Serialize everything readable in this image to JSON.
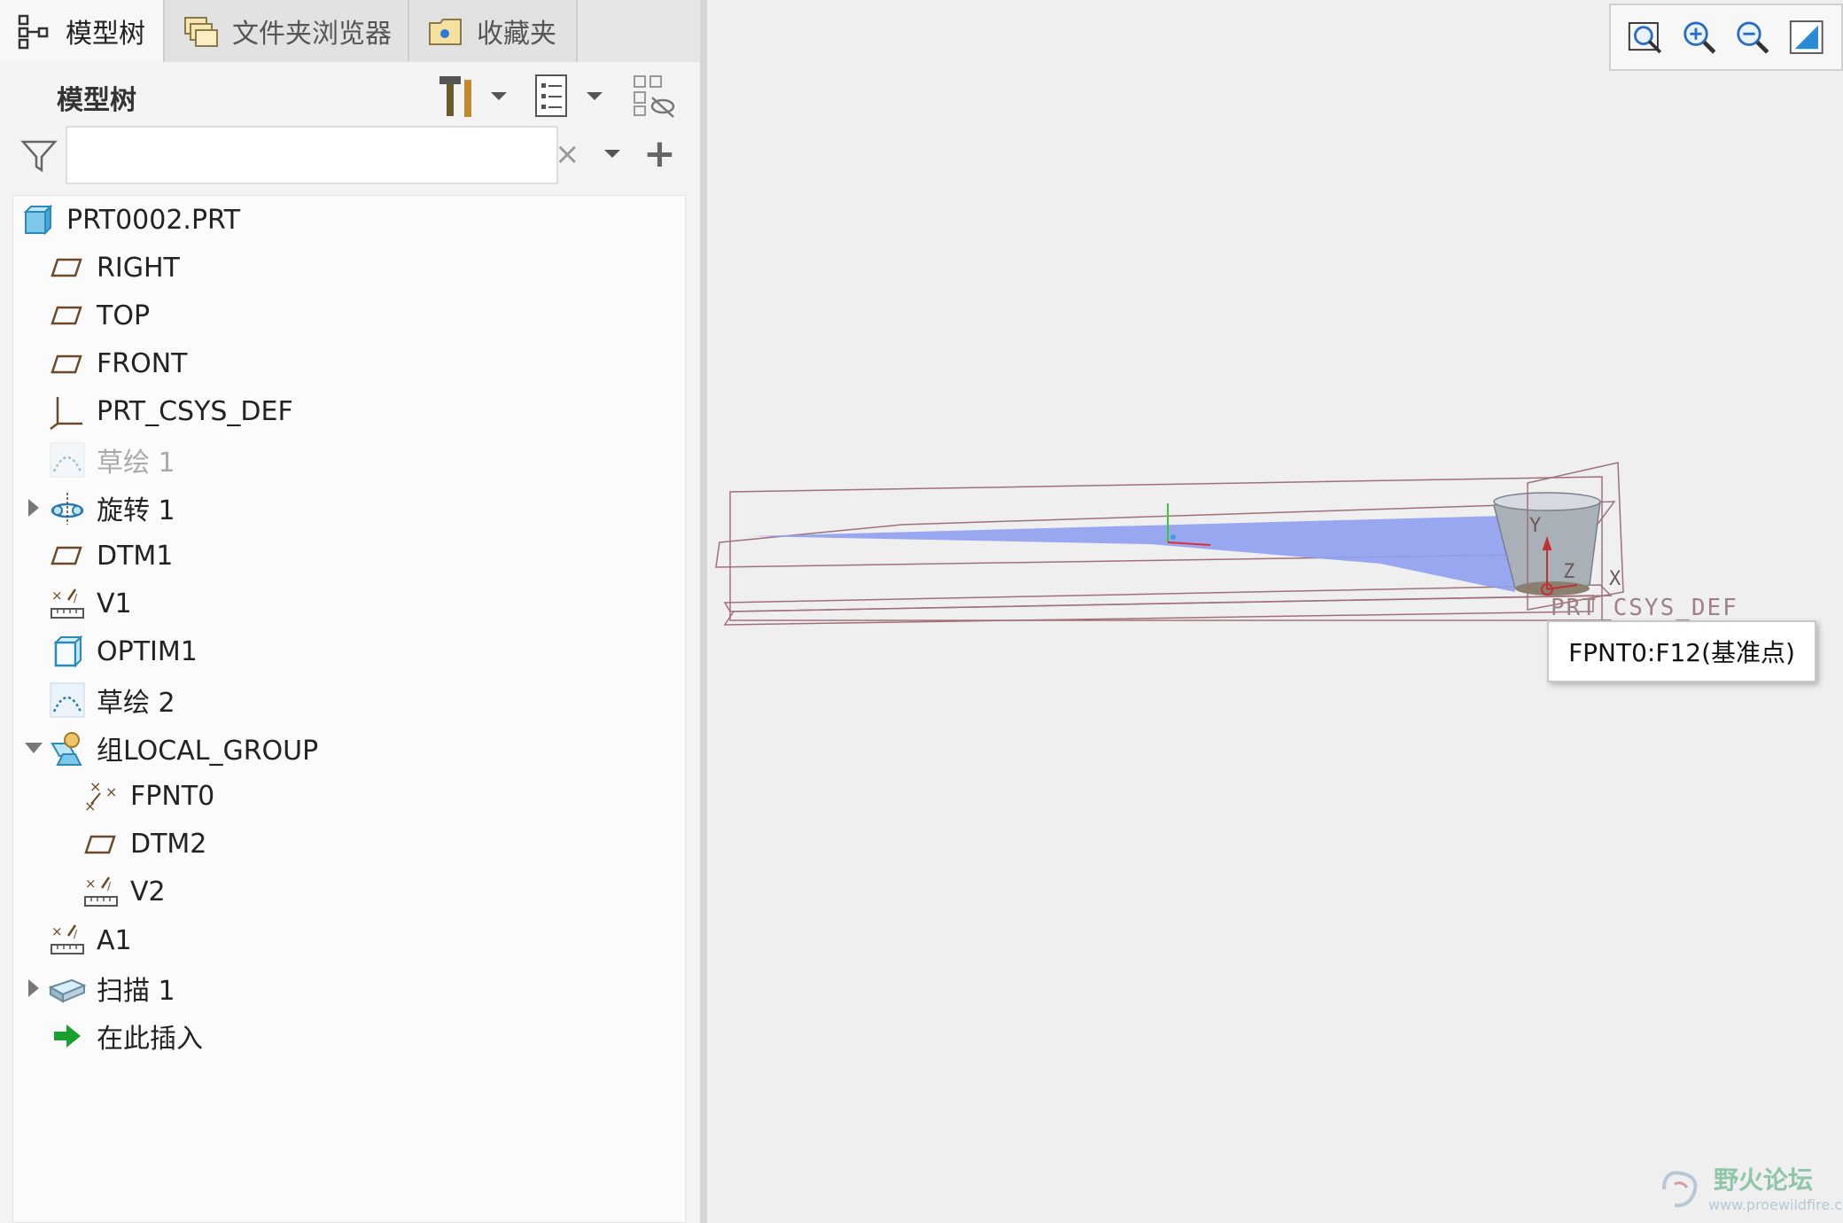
{
  "tabs": [
    {
      "label": "模型树",
      "icon": "model-tree-icon"
    },
    {
      "label": "文件夹浏览器",
      "icon": "folder-browser-icon"
    },
    {
      "label": "收藏夹",
      "icon": "favorites-icon"
    }
  ],
  "tree_header": {
    "title": "模型树",
    "buttons": [
      "settings-tools-icon",
      "tree-columns-icon",
      "show-hidden-icon"
    ]
  },
  "filter": {
    "value": "",
    "placeholder": "",
    "clear_glyph": "×",
    "add_glyph": "+"
  },
  "tree": {
    "items": [
      {
        "label": "PRT0002.PRT",
        "icon": "part-icon"
      },
      {
        "label": "RIGHT",
        "icon": "datum-plane-icon"
      },
      {
        "label": "TOP",
        "icon": "datum-plane-icon"
      },
      {
        "label": "FRONT",
        "icon": "datum-plane-icon"
      },
      {
        "label": "PRT_CSYS_DEF",
        "icon": "coordinate-system-icon"
      },
      {
        "label": "草绘 1",
        "icon": "sketch-icon",
        "dimmed": true
      },
      {
        "label": "旋转 1",
        "icon": "revolve-icon",
        "expander": "collapsed"
      },
      {
        "label": "DTM1",
        "icon": "datum-plane-icon"
      },
      {
        "label": "V1",
        "icon": "analysis-icon"
      },
      {
        "label": "OPTIM1",
        "icon": "optimization-icon"
      },
      {
        "label": "草绘 2",
        "icon": "sketch-icon"
      },
      {
        "label": "组LOCAL_GROUP",
        "icon": "group-icon",
        "expander": "expanded"
      },
      {
        "label": "FPNT0",
        "icon": "datum-point-icon",
        "indent": 1
      },
      {
        "label": "DTM2",
        "icon": "datum-plane-icon",
        "indent": 1
      },
      {
        "label": "V2",
        "icon": "analysis-icon",
        "indent": 1
      },
      {
        "label": "A1",
        "icon": "analysis-icon"
      },
      {
        "label": "扫描 1",
        "icon": "sweep-icon",
        "expander": "collapsed"
      },
      {
        "label": "在此插入",
        "icon": "insert-here-arrow-icon"
      }
    ]
  },
  "view_toolbar": [
    "refit-icon",
    "zoom-in-icon",
    "zoom-out-icon",
    "repaint-icon"
  ],
  "scene": {
    "csys_label": "PRT_CSYS_DEF",
    "axis_x": "X",
    "axis_y": "Y",
    "axis_z": "Z",
    "surface_color": "#8f9ff0",
    "datum_color": "#a0707a"
  },
  "tooltip": "FPNT0:F12(基准点)",
  "watermark": {
    "title": "野火论坛",
    "url": "www.proewildfire.cn"
  }
}
